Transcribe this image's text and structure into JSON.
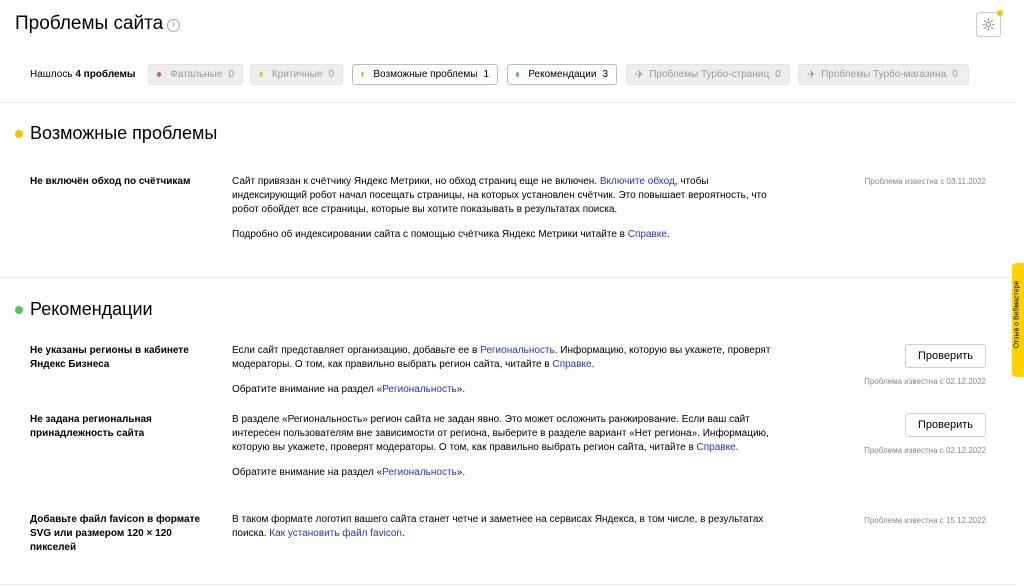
{
  "header": {
    "title": "Проблемы сайта",
    "info_glyph": "i"
  },
  "filters": {
    "found_prefix": "Нашлось",
    "found_count": "4 проблемы",
    "chips": [
      {
        "label": "Фатальные",
        "count": "0",
        "color": "#e05a5a"
      },
      {
        "label": "Критичные",
        "count": "0",
        "color": "#e8c44c"
      },
      {
        "label": "Возможные проблемы",
        "count": "1",
        "color": "#f2c200"
      },
      {
        "label": "Рекомендации",
        "count": "3",
        "color": "#5cc25c"
      },
      {
        "label": "Проблемы Турбо-страниц",
        "count": "0"
      },
      {
        "label": "Проблемы Турбо-магазина",
        "count": "0"
      }
    ]
  },
  "sections": {
    "possible": {
      "title": "Возможные проблемы",
      "color": "#f2c200",
      "items": [
        {
          "title": "Не включён обход по счётчикам",
          "p1_a": "Сайт привязан к счётчику Яндекс Метрики, но обход страниц еще не включен. ",
          "p1_link": "Включите обход",
          "p1_b": ", чтобы индексирующий робот начал посещать страницы, на которых установлен счётчик. Это повышает вероятность, что робот обойдет все страницы, которые вы хотите показывать в результатах поиска.",
          "p2_a": "Подробно об индексировании сайта с помощью счётчика Яндекс Метрики читайте в ",
          "p2_link": "Справке",
          "p2_b": ".",
          "date": "Проблема известна с 03.11.2022"
        }
      ]
    },
    "recommendations": {
      "title": "Рекомендации",
      "color": "#5cc25c",
      "items": [
        {
          "title": "Не указаны регионы в кабинете Яндекс Бизнеса",
          "p1_a": "Если сайт представляет организацию, добавьте ее в ",
          "p1_link": "Региональность",
          "p1_b": ". Информацию, которую вы укажете, проверят модераторы. О том, как правильно выбрать регион сайта, читайте в ",
          "p1_link2": "Справке",
          "p1_c": ".",
          "p2_a": "Обратите внимание на раздел «",
          "p2_link": "Региональность",
          "p2_b": "».",
          "button": "Проверить",
          "date": "Проблема известна с 02.12.2022"
        },
        {
          "title": "Не задана региональная принадлежность сайта",
          "p1_a": "В разделе «Региональность» регион сайта не задан явно. Это может осложнить ранжирование. Если ваш сайт интересен пользователям вне зависимости от региона, выберите в разделе вариант «Нет региона». Информацию, которую вы укажете, проверят модераторы. О том, как правильно выбрать регион сайта, читайте в ",
          "p1_link": "Справке",
          "p1_b": ".",
          "p2_a": "Обратите внимание на раздел «",
          "p2_link": "Региональность",
          "p2_b": "».",
          "button": "Проверить",
          "date": "Проблема известна с 02.12.2022"
        },
        {
          "title": "Добавьте файл favicon в формате SVG или размером 120 × 120 пикселей",
          "p1_a": "В таком формате логотип вашего сайта станет четче и заметнее на сервисах Яндекса, в том числе, в результатах поиска. ",
          "p1_link": "Как установить файл favicon",
          "p1_b": ".",
          "date": "Проблема известна с 15.12.2022"
        }
      ]
    }
  },
  "feedback": {
    "label": "Отзыв о Вебмастере"
  }
}
